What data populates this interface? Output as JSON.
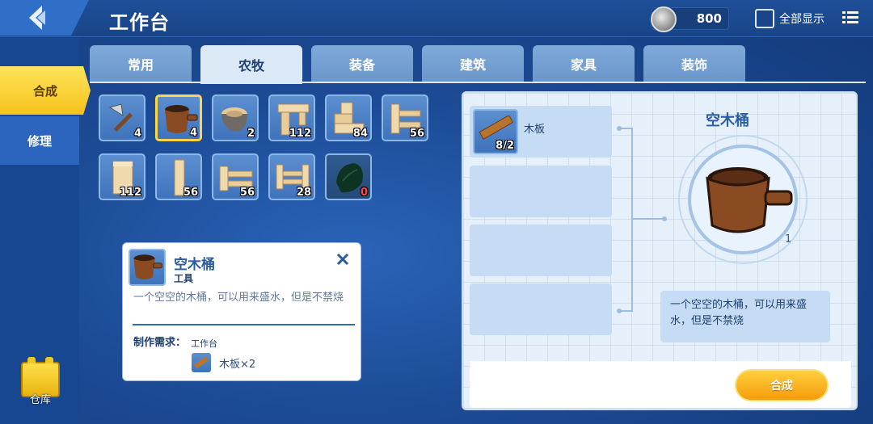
{
  "header": {
    "title": "工作台",
    "currency_value": "800",
    "show_all_label": "全部显示"
  },
  "sidebar": {
    "items": [
      {
        "label": "合成",
        "active": true
      },
      {
        "label": "修理",
        "active": false
      }
    ],
    "storage_label": "仓库"
  },
  "tabs": [
    {
      "label": "常用",
      "active": false
    },
    {
      "label": "农牧",
      "active": true
    },
    {
      "label": "装备",
      "active": false
    },
    {
      "label": "建筑",
      "active": false
    },
    {
      "label": "家具",
      "active": false
    },
    {
      "label": "装饰",
      "active": false
    }
  ],
  "grid": {
    "items": [
      {
        "icon": "axe-icon",
        "count": "4"
      },
      {
        "icon": "wooden-bucket-icon",
        "count": "4",
        "selected": true
      },
      {
        "icon": "stone-bowl-icon",
        "count": "2"
      },
      {
        "icon": "wood-table-icon",
        "count": "112"
      },
      {
        "icon": "wood-steps-icon",
        "count": "84"
      },
      {
        "icon": "wood-fence-corner-icon",
        "count": "56"
      },
      {
        "icon": "wood-block-icon",
        "count": "112"
      },
      {
        "icon": "wood-post-icon",
        "count": "56"
      },
      {
        "icon": "wood-fence-icon",
        "count": "56"
      },
      {
        "icon": "wood-fence-gate-icon",
        "count": "28"
      },
      {
        "icon": "dark-leaf-icon",
        "count": "0"
      }
    ]
  },
  "tooltip": {
    "name": "空木桶",
    "type": "工具",
    "description": "一个空空的木桶，可以用来盛水，但是不禁烧",
    "requirement_label": "制作需求：",
    "station": "工作台",
    "material": "木板×2"
  },
  "recipe": {
    "result_name": "空木桶",
    "result_count": "1",
    "ingredients": [
      {
        "name": "木板",
        "count": "8/2"
      }
    ],
    "description": "一个空空的木桶，可以用来盛水，但是不禁烧",
    "craft_button_label": "合成"
  },
  "colors": {
    "accent_yellow": "#f5c21a",
    "panel_blue": "#1c4a94",
    "craft_orange": "#f59d0c"
  }
}
